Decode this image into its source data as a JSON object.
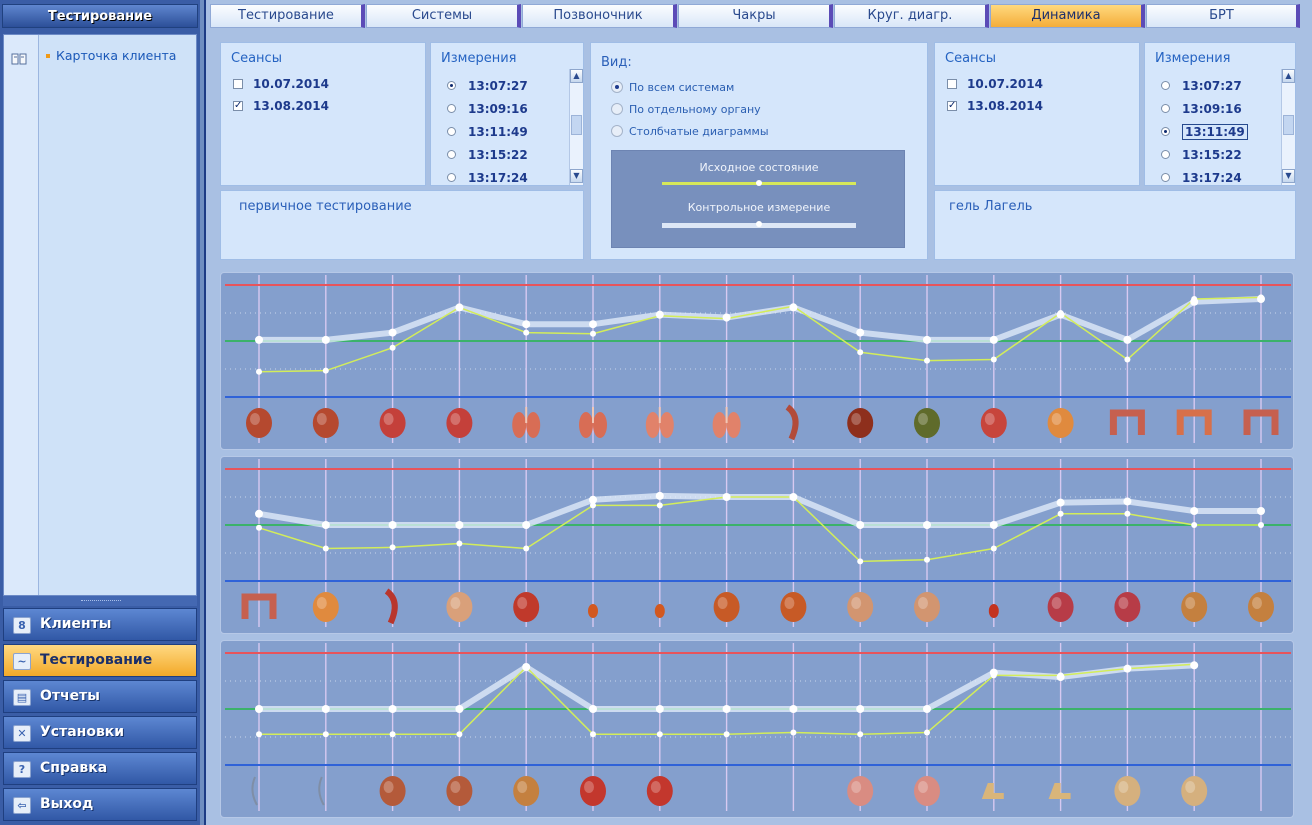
{
  "sidebar": {
    "title": "Тестирование",
    "tree_item": "Карточка клиента",
    "nav": [
      {
        "label": "Клиенты",
        "icon": "clients-icon",
        "glyph": "8",
        "active": false
      },
      {
        "label": "Тестирование",
        "icon": "chart-icon",
        "glyph": "~",
        "active": true
      },
      {
        "label": "Отчеты",
        "icon": "printer-icon",
        "glyph": "▤",
        "active": false
      },
      {
        "label": "Установки",
        "icon": "tools-icon",
        "glyph": "✕",
        "active": false
      },
      {
        "label": "Справка",
        "icon": "help-icon",
        "glyph": "?",
        "active": false
      },
      {
        "label": "Выход",
        "icon": "exit-icon",
        "glyph": "⇦",
        "active": false
      }
    ]
  },
  "tabs": [
    "Тестирование",
    "Системы",
    "Позвоночник",
    "Чакры",
    "Круг. диагр.",
    "Динамика",
    "БРТ"
  ],
  "active_tab": 5,
  "left_sessions": {
    "title": "Сеансы",
    "items": [
      {
        "date": "10.07.2014",
        "checked": false
      },
      {
        "date": "13.08.2014",
        "checked": true
      }
    ],
    "note": "первичное тестирование"
  },
  "left_measurements": {
    "title": "Измерения",
    "items": [
      "13:07:27",
      "13:09:16",
      "13:11:49",
      "13:15:22",
      "13:17:24"
    ],
    "selected": 0
  },
  "view": {
    "title": "Вид:",
    "options": [
      "По всем системам",
      "По отдельному органу",
      "Столбчатые диаграммы"
    ],
    "selected": 0,
    "slider1_label": "Исходное состояние",
    "slider2_label": "Контрольное измерение",
    "slider1_value": 0.5,
    "slider2_value": 0.5
  },
  "right_sessions": {
    "title": "Сеансы",
    "items": [
      {
        "date": "10.07.2014",
        "checked": false
      },
      {
        "date": "13.08.2014",
        "checked": true
      }
    ],
    "note": "гель Лагель"
  },
  "right_measurements": {
    "title": "Измерения",
    "items": [
      "13:07:27",
      "13:09:16",
      "13:11:49",
      "13:15:22",
      "13:17:24"
    ],
    "selected": 2
  },
  "colors": {
    "upper_line": "#e8545b",
    "norm_line": "#3bb26a",
    "lower_line": "#2f62d8",
    "initial_line": "#d3ed5a",
    "control_line": "#e6effb",
    "grid_line": "#d7c9f1",
    "tab_separator": "#5b4bb7",
    "active_tab": "#f4ad3a",
    "sidebar": "#3a5da6"
  },
  "chart_data": [
    {
      "type": "line",
      "ylim": [
        -1,
        1
      ],
      "reference_lines": [
        1,
        0,
        -1
      ],
      "series": [
        {
          "values": [
            -0.55,
            -0.53,
            -0.12,
            0.6,
            0.15,
            0.13,
            0.45,
            0.4,
            0.62,
            -0.2,
            -0.35,
            -0.33,
            0.5,
            -0.33,
            0.75,
            0.78
          ]
        },
        {
          "values": [
            0.02,
            0.02,
            0.15,
            0.6,
            0.3,
            0.3,
            0.47,
            0.42,
            0.6,
            0.15,
            0.02,
            0.02,
            0.47,
            0.02,
            0.7,
            0.75
          ]
        }
      ],
      "organs": [
        "heart-icon",
        "heart-icon",
        "vessels-icon",
        "vessels-icon",
        "bronchi-icon",
        "bronchi-icon",
        "lungs-icon",
        "lungs-icon",
        "esophagus-icon",
        "liver-icon",
        "gallbladder-icon",
        "stomach-icon",
        "pancreas-icon",
        "colon-icon",
        "intestine-icon",
        "colon-icon"
      ]
    },
    {
      "type": "line",
      "ylim": [
        -1,
        1
      ],
      "reference_lines": [
        1,
        0,
        -1
      ],
      "series": [
        {
          "values": [
            -0.05,
            -0.42,
            -0.4,
            -0.33,
            -0.42,
            0.35,
            0.35,
            0.5,
            0.5,
            -0.65,
            -0.62,
            -0.42,
            0.2,
            0.2,
            0.0,
            0.0
          ]
        },
        {
          "values": [
            0.2,
            0.0,
            0.0,
            0.0,
            0.0,
            0.45,
            0.52,
            0.5,
            0.5,
            0.0,
            0.0,
            0.0,
            0.4,
            0.42,
            0.25,
            0.25
          ]
        }
      ],
      "organs": [
        "colon-icon",
        "pancreas-icon",
        "ureter-icon",
        "bladder-icon",
        "uterus-icon",
        "ovary-icon",
        "ovary-icon",
        "kidney-icon",
        "kidney-icon",
        "brain-icon",
        "brain-icon",
        "adrenal-icon",
        "thyroid-icon",
        "thyroid-icon",
        "ear-icon",
        "ear-icon"
      ]
    },
    {
      "type": "line",
      "ylim": [
        -1,
        1
      ],
      "reference_lines": [
        1,
        0,
        -1
      ],
      "series": [
        {
          "values": [
            -0.45,
            -0.45,
            -0.45,
            -0.45,
            0.75,
            -0.45,
            -0.45,
            -0.45,
            -0.42,
            -0.45,
            -0.42,
            0.6,
            0.6,
            0.72,
            0.8,
            null
          ]
        },
        {
          "values": [
            0.0,
            0.0,
            0.0,
            0.0,
            0.75,
            0.0,
            0.0,
            0.0,
            0.0,
            0.0,
            0.0,
            0.65,
            0.57,
            0.72,
            0.78,
            null
          ]
        }
      ],
      "organs": [
        "nerve-icon",
        "nerve-icon",
        "eye-icon",
        "eye-icon",
        "ear-icon",
        "mouth-icon",
        "mouth-icon",
        "",
        "",
        "larynx-icon",
        "larynx-icon",
        "foot-icon",
        "foot-icon",
        "knee-icon",
        "knee-icon",
        ""
      ]
    }
  ]
}
